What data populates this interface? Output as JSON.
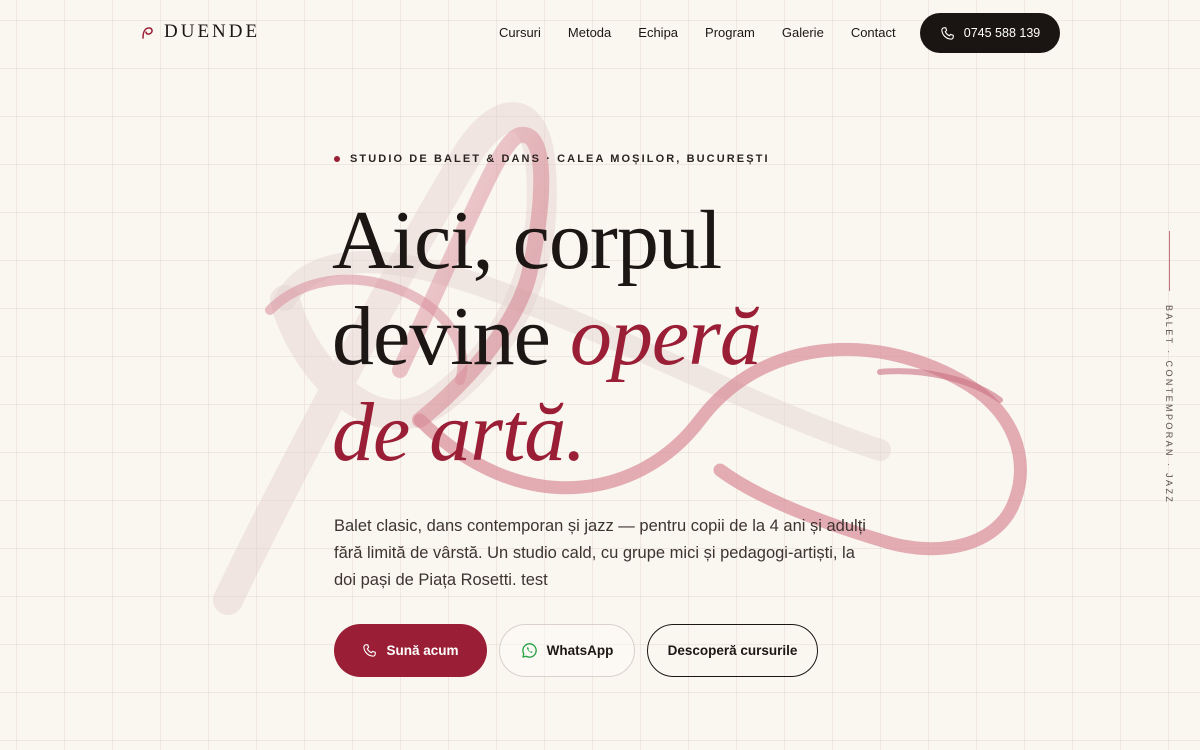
{
  "brand": {
    "name": "DUENDE",
    "accent_color": "#9a1f36",
    "dark_color": "#1a1412",
    "background_color": "#faf6f0"
  },
  "nav": {
    "items": [
      {
        "label": "Cursuri"
      },
      {
        "label": "Metoda"
      },
      {
        "label": "Echipa"
      },
      {
        "label": "Program"
      },
      {
        "label": "Galerie"
      },
      {
        "label": "Contact"
      }
    ],
    "phone": "0745 588 139",
    "phone_icon": "phone-icon"
  },
  "hero": {
    "eyebrow": "STUDIO DE BALET & DANS · CALEA MOȘILOR, BUCUREȘTI",
    "headline": {
      "line1": "Aici, corpul",
      "line2_plain": "devine ",
      "line2_accent": "operă",
      "line3_accent": "de artă."
    },
    "lead": "Balet clasic, dans contemporan și jazz — pentru copii de la 4 ani și adulți fără limită de vârstă. Un studio cald, cu grupe mici și pedagogi-artiști, la doi pași de Piața Rosetti. test",
    "buttons": {
      "call": {
        "label": "Sună acum",
        "icon": "phone-icon"
      },
      "whatsapp": {
        "label": "WhatsApp",
        "icon": "whatsapp-icon"
      },
      "courses": {
        "label": "Descoperă cursurile"
      }
    }
  },
  "side_label": "BALET · CONTEMPORAN · JAZZ"
}
